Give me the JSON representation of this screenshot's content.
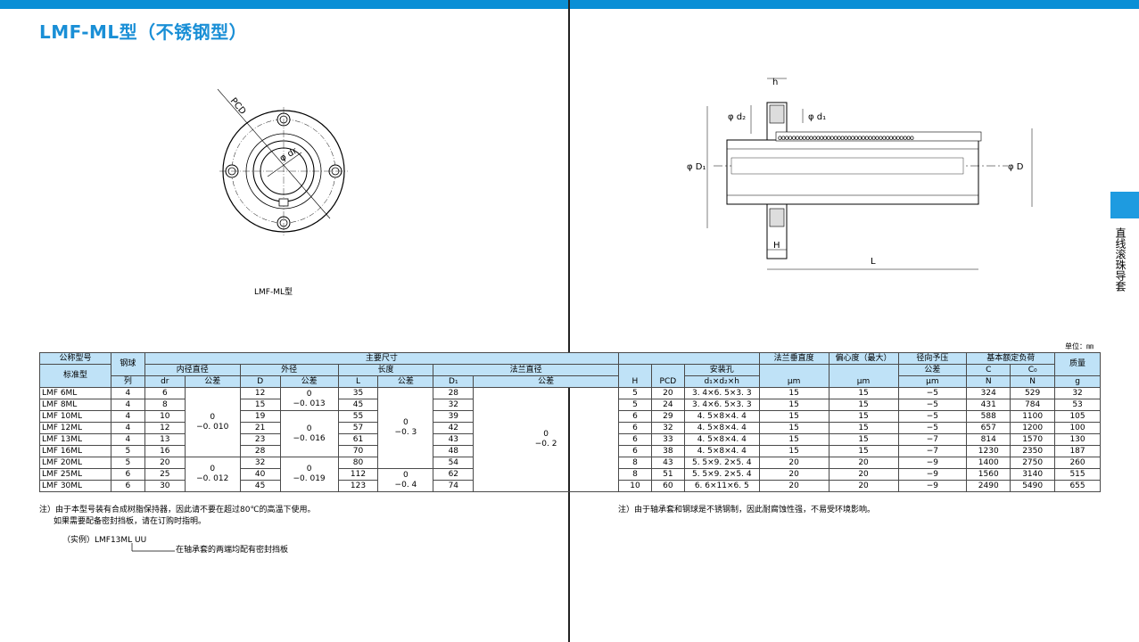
{
  "title": "LMF-ML型（不锈钢型）",
  "fig_caption": "LMF-ML型",
  "side_label": "直线滚珠导套",
  "unit": "单位：㎜",
  "drawing_labels": {
    "pcd": "PCD",
    "phi_dr": "φ dr",
    "h": "h",
    "phi_d2": "φ d₂",
    "phi_d1": "φ d₁",
    "phi_D1": "φ D₁",
    "phi_D": "φ D",
    "H": "H",
    "L": "L"
  },
  "left_table": {
    "header": {
      "model": "公称型号",
      "std": "标准型",
      "balls": "钢球",
      "rows_lbl": "列",
      "main_dims": "主要尺寸",
      "inner": "内径直径",
      "outer": "外径",
      "length": "长度",
      "flange": "法兰直径",
      "tol": "公差",
      "dr": "dr",
      "D": "D",
      "L": "L",
      "D1": "D₁"
    },
    "rows": [
      {
        "model": "LMF  6ML",
        "balls": "4",
        "dr": "6",
        "D": "12",
        "L": "35",
        "D1": "28"
      },
      {
        "model": "LMF  8ML",
        "balls": "4",
        "dr": "8",
        "D": "15",
        "L": "45",
        "D1": "32"
      },
      {
        "model": "LMF  10ML",
        "balls": "4",
        "dr": "10",
        "D": "19",
        "L": "55",
        "D1": "39"
      },
      {
        "model": "LMF  12ML",
        "balls": "4",
        "dr": "12",
        "D": "21",
        "L": "57",
        "D1": "42"
      },
      {
        "model": "LMF  13ML",
        "balls": "4",
        "dr": "13",
        "D": "23",
        "L": "61",
        "D1": "43"
      },
      {
        "model": "LMF  16ML",
        "balls": "5",
        "dr": "16",
        "D": "28",
        "L": "70",
        "D1": "48"
      },
      {
        "model": "LMF  20ML",
        "balls": "5",
        "dr": "20",
        "D": "32",
        "L": "80",
        "D1": "54"
      },
      {
        "model": "LMF  25ML",
        "balls": "6",
        "dr": "25",
        "D": "40",
        "L": "112",
        "D1": "62"
      },
      {
        "model": "LMF  30ML",
        "balls": "6",
        "dr": "30",
        "D": "45",
        "L": "123",
        "D1": "74"
      }
    ],
    "tols": {
      "dr_a_top": "0",
      "dr_a_bot": "−0. 010",
      "dr_b_top": "0",
      "dr_b_bot": "−0. 012",
      "D_a_top": "0",
      "D_a_bot": "−0. 013",
      "D_b_top": "0",
      "D_b_bot": "−0. 016",
      "D_c_top": "0",
      "D_c_bot": "−0. 019",
      "L_a_top": "0",
      "L_a_bot": "−0. 3",
      "L_b_top": "0",
      "L_b_bot": "−0. 4",
      "D1_top": "0",
      "D1_bot": "−0. 2"
    }
  },
  "right_table": {
    "header": {
      "H": "H",
      "PCD": "PCD",
      "hole": "安装孔",
      "hole_dims": "d₁×d₂×h",
      "perp": "法兰垂直度",
      "perp_u": "μm",
      "ecc": "偏心度（最大）",
      "ecc_u": "μm",
      "pre": "径向予压",
      "pre_tol": "公差",
      "pre_u": "μm",
      "load": "基本额定负荷",
      "C": "C",
      "C0": "C₀",
      "N1": "N",
      "N2": "N",
      "mass": "质量",
      "g": "g"
    },
    "rows": [
      {
        "H": "5",
        "PCD": "20",
        "hole": "3. 4×6. 5×3. 3",
        "perp": "15",
        "ecc": "15",
        "pre": "−5",
        "C": "324",
        "C0": "529",
        "mass": "32"
      },
      {
        "H": "5",
        "PCD": "24",
        "hole": "3. 4×6. 5×3. 3",
        "perp": "15",
        "ecc": "15",
        "pre": "−5",
        "C": "431",
        "C0": "784",
        "mass": "53"
      },
      {
        "H": "6",
        "PCD": "29",
        "hole": "4. 5×8×4. 4",
        "perp": "15",
        "ecc": "15",
        "pre": "−5",
        "C": "588",
        "C0": "1100",
        "mass": "105"
      },
      {
        "H": "6",
        "PCD": "32",
        "hole": "4. 5×8×4. 4",
        "perp": "15",
        "ecc": "15",
        "pre": "−5",
        "C": "657",
        "C0": "1200",
        "mass": "100"
      },
      {
        "H": "6",
        "PCD": "33",
        "hole": "4. 5×8×4. 4",
        "perp": "15",
        "ecc": "15",
        "pre": "−7",
        "C": "814",
        "C0": "1570",
        "mass": "130"
      },
      {
        "H": "6",
        "PCD": "38",
        "hole": "4. 5×8×4. 4",
        "perp": "15",
        "ecc": "15",
        "pre": "−7",
        "C": "1230",
        "C0": "2350",
        "mass": "187"
      },
      {
        "H": "8",
        "PCD": "43",
        "hole": "5. 5×9. 2×5. 4",
        "perp": "20",
        "ecc": "20",
        "pre": "−9",
        "C": "1400",
        "C0": "2750",
        "mass": "260"
      },
      {
        "H": "8",
        "PCD": "51",
        "hole": "5. 5×9. 2×5. 4",
        "perp": "20",
        "ecc": "20",
        "pre": "−9",
        "C": "1560",
        "C0": "3140",
        "mass": "515"
      },
      {
        "H": "10",
        "PCD": "60",
        "hole": "6. 6×11×6. 5",
        "perp": "20",
        "ecc": "20",
        "pre": "−9",
        "C": "2490",
        "C0": "5490",
        "mass": "655"
      }
    ]
  },
  "notes_left": {
    "line1": "注）由于本型号装有合成树脂保持器，因此请不要在超过80℃的高温下使用。",
    "line2": "如果需要配备密封挡板，请在订购时指明。",
    "example": "（实例）LMF13ML UU",
    "example_note": "在轴承套的两端均配有密封挡板"
  },
  "notes_right": {
    "line1": "注）由于轴承套和钢球是不锈钢制，因此耐腐蚀性强，不易受环境影响。"
  },
  "colors": {
    "accent": "#1a8fd6",
    "header_bg": "#bfe2f7",
    "side_tab": "#1e9be0"
  }
}
